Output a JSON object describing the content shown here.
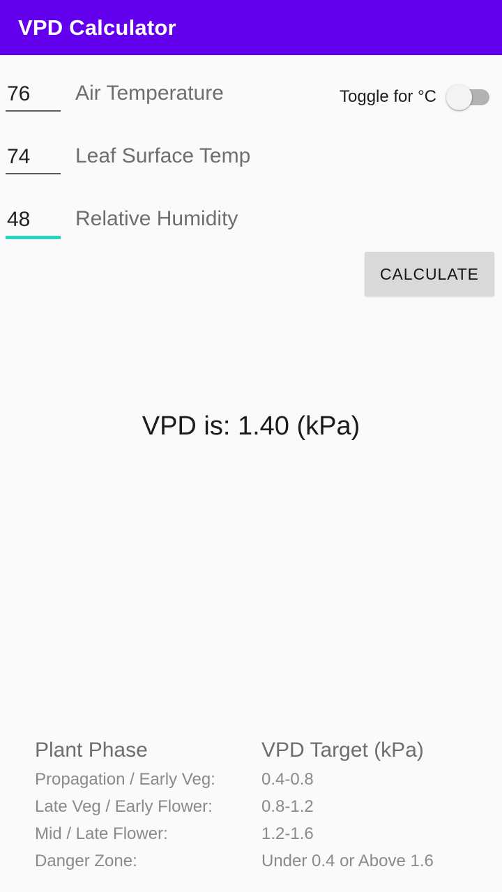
{
  "appbar": {
    "title": "VPD Calculator",
    "background": "#6200ee",
    "text_color": "#ffffff"
  },
  "colors": {
    "accent_teal": "#2ad3c4",
    "background": "#fafafa",
    "button_gray": "#d8d9d8",
    "label_gray": "#6e6e6e",
    "table_text_gray": "#8a8a8a"
  },
  "form": {
    "fields": [
      {
        "value": "76",
        "placeholder": "",
        "label": "Air Temperature",
        "focused": false
      },
      {
        "value": "74",
        "placeholder": "",
        "label": "Leaf Surface Temp",
        "focused": false
      },
      {
        "value": "48",
        "placeholder": "",
        "label": "Relative Humidity",
        "focused": true
      }
    ],
    "toggle": {
      "label": "Toggle for °C",
      "state": "off"
    },
    "calculate_label": "CALCULATE"
  },
  "result": {
    "text": "VPD is: 1.40 (kPa)",
    "value": "1.40",
    "unit": "kPa"
  },
  "reference": {
    "headers": {
      "phase": "Plant Phase",
      "target": "VPD Target (kPa)"
    },
    "rows": [
      {
        "phase": "Propagation / Early Veg:",
        "target": "0.4-0.8"
      },
      {
        "phase": "Late Veg / Early Flower:",
        "target": "0.8-1.2"
      },
      {
        "phase": "Mid / Late Flower:",
        "target": "1.2-1.6"
      },
      {
        "phase": "Danger Zone:",
        "target": "Under 0.4 or Above 1.6"
      }
    ]
  }
}
